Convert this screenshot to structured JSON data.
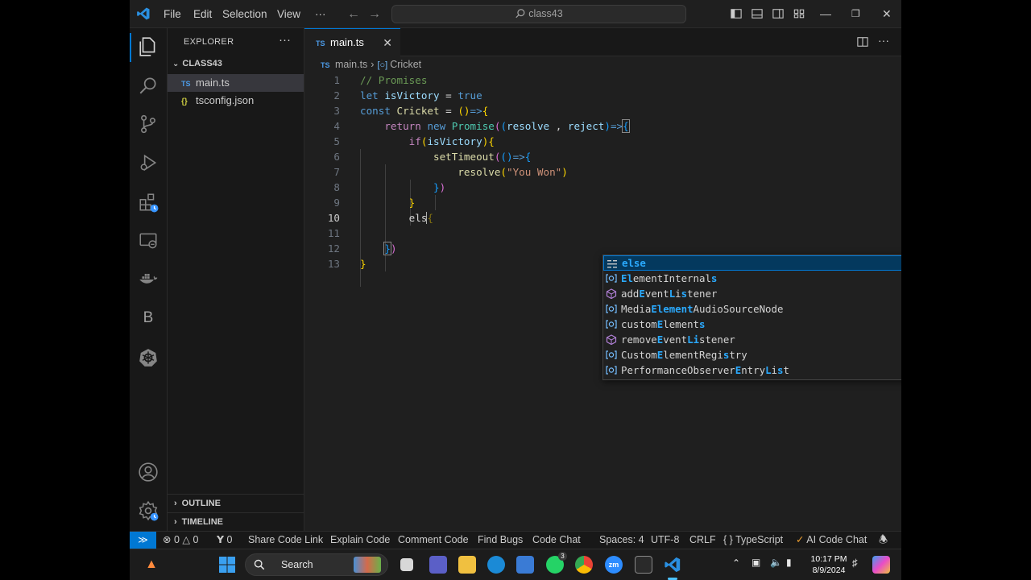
{
  "titlebar": {
    "menus": [
      "File",
      "Edit",
      "Selection",
      "View",
      "···"
    ],
    "search_text": "class43"
  },
  "sidebar": {
    "title": "EXPLORER",
    "more": "···",
    "folder": "CLASS43",
    "files": [
      {
        "badge": "TS",
        "name": "main.ts"
      },
      {
        "badge": "{}",
        "name": "tsconfig.json"
      }
    ],
    "outline": "OUTLINE",
    "timeline": "TIMELINE"
  },
  "activity_icons": [
    "files-icon",
    "search-icon",
    "source-control-icon",
    "run-debug-icon",
    "extensions-icon",
    "remote-explorer-icon",
    "docker-icon",
    "b-icon",
    "kubernetes-icon",
    "account-icon",
    "settings-icon"
  ],
  "activity_b": "B",
  "editor": {
    "tab": {
      "badge": "TS",
      "label": "main.ts",
      "close": "✕"
    },
    "breadcrumb": {
      "badge": "TS",
      "file": "main.ts",
      "sep": "›",
      "symbol": "Cricket"
    },
    "line_numbers": [
      "1",
      "2",
      "3",
      "4",
      "5",
      "6",
      "7",
      "8",
      "9",
      "10",
      "11",
      "12",
      "13"
    ],
    "code": {
      "l1": "// Promises",
      "l2a": "let",
      "l2b": "isVictory",
      "l2c": " = ",
      "l2d": "true",
      "l3a": "const",
      "l3b": "Cricket",
      "l3c": " = ",
      "l3d": "()",
      "l3e": "=>",
      "l3f": "{",
      "l4a": "return",
      "l4b": "new",
      "l4c": "Promise",
      "l4d": "(",
      "l4e": "(",
      "l4f": "resolve",
      "l4g": " , ",
      "l4h": "reject",
      "l4i": ")",
      "l4j": "=>",
      "l4k": "{",
      "l5a": "if",
      "l5b": "(",
      "l5c": "isVictory",
      "l5d": ")",
      "l5e": "{",
      "l6a": "setTimeout",
      "l6b": "(",
      "l6c": "()",
      "l6d": "=>",
      "l6e": "{",
      "l7a": "resolve",
      "l7b": "(",
      "l7c": "\"You Won\"",
      "l7d": ")",
      "l8a": "}",
      "l8b": ")",
      "l9a": "}",
      "l10a": "els",
      "l10b": "{",
      "l12a": "}",
      "l12b": ")",
      "l13a": "}"
    }
  },
  "suggestions": [
    {
      "kind": "keyword",
      "parts": [
        [
          "else",
          true
        ]
      ]
    },
    {
      "kind": "variable",
      "parts": [
        [
          "El",
          true
        ],
        [
          "ementInternal",
          false
        ],
        [
          "s",
          true
        ]
      ]
    },
    {
      "kind": "method",
      "parts": [
        [
          "add",
          false
        ],
        [
          "E",
          true
        ],
        [
          "vent",
          false
        ],
        [
          "L",
          true
        ],
        [
          "i",
          false
        ],
        [
          "s",
          true
        ],
        [
          "tener",
          false
        ]
      ]
    },
    {
      "kind": "variable",
      "parts": [
        [
          "Media",
          false
        ],
        [
          "Element",
          true
        ],
        [
          "AudioSourceNode",
          false
        ]
      ]
    },
    {
      "kind": "variable",
      "parts": [
        [
          "custom",
          false
        ],
        [
          "E",
          true
        ],
        [
          "lement",
          false
        ],
        [
          "s",
          true
        ]
      ]
    },
    {
      "kind": "method",
      "parts": [
        [
          "remove",
          false
        ],
        [
          "E",
          true
        ],
        [
          "vent",
          false
        ],
        [
          "Li",
          true
        ],
        [
          "s",
          false
        ],
        [
          "tener",
          false
        ]
      ]
    },
    {
      "kind": "variable",
      "parts": [
        [
          "Custom",
          false
        ],
        [
          "E",
          true
        ],
        [
          "lementRegi",
          false
        ],
        [
          "s",
          true
        ],
        [
          "try",
          false
        ]
      ]
    },
    {
      "kind": "variable",
      "parts": [
        [
          "PerformanceObserver",
          false
        ],
        [
          "E",
          true
        ],
        [
          "ntry",
          false
        ],
        [
          "L",
          true
        ],
        [
          "i",
          false
        ],
        [
          "s",
          true
        ],
        [
          "t",
          false
        ]
      ]
    }
  ],
  "statusbar": {
    "remote": "≫",
    "errors": "0",
    "warnings": "0",
    "ports": "0",
    "items_left": [
      "Share Code Link",
      "Explain Code",
      "Comment Code",
      "Find Bugs",
      "Code Chat"
    ],
    "spaces": "Spaces: 4",
    "encoding": "UTF-8",
    "eol": "CRLF",
    "language_icon": "{ }",
    "language": "TypeScript",
    "ai_chat": "AI Code Chat"
  },
  "taskbar": {
    "search": "Search",
    "time": "10:17 PM",
    "date": "8/9/2024",
    "whatsapp_badge": "3"
  },
  "colors": {
    "accent": "#0078d4",
    "editor_bg": "#1f1f1f",
    "sidebar_bg": "#181818",
    "suggest_highlight": "#2aaaff"
  }
}
